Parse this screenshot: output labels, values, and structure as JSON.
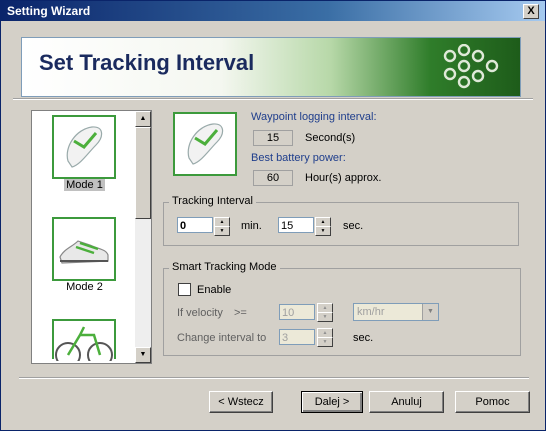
{
  "window": {
    "title": "Setting Wizard",
    "close_glyph": "X"
  },
  "header": {
    "title": "Set Tracking Interval"
  },
  "modes": [
    {
      "label": "Mode 1",
      "icon": "flip-flop-icon",
      "selected": true
    },
    {
      "label": "Mode 2",
      "icon": "sneaker-icon",
      "selected": false
    },
    {
      "icon": "bicycle-icon",
      "selected": false
    }
  ],
  "preview": {
    "icon": "flip-flop-icon"
  },
  "info": {
    "logging_label": "Waypoint logging interval:",
    "logging_value": "15",
    "logging_unit": "Second(s)",
    "battery_label": "Best battery power:",
    "battery_value": "60",
    "battery_unit": "Hour(s) approx."
  },
  "tracking": {
    "legend": "Tracking Interval",
    "min_value": "0",
    "min_label": "min.",
    "sec_value": "15",
    "sec_label": "sec."
  },
  "smart": {
    "legend": "Smart Tracking Mode",
    "enable_label": "Enable",
    "enabled": false,
    "velocity_label": "If velocity",
    "operator": ">=",
    "velocity_value": "10",
    "velocity_unit": "km/hr",
    "change_label": "Change interval to",
    "change_value": "3",
    "change_unit": "sec."
  },
  "buttons": {
    "back": "< Wstecz",
    "next": "Dalej >",
    "cancel": "Anuluj",
    "help": "Pomoc"
  },
  "colors": {
    "accent_green": "#3c9a3c",
    "title_blue": "#1a2a5e",
    "info_blue": "#1f3e8c"
  }
}
